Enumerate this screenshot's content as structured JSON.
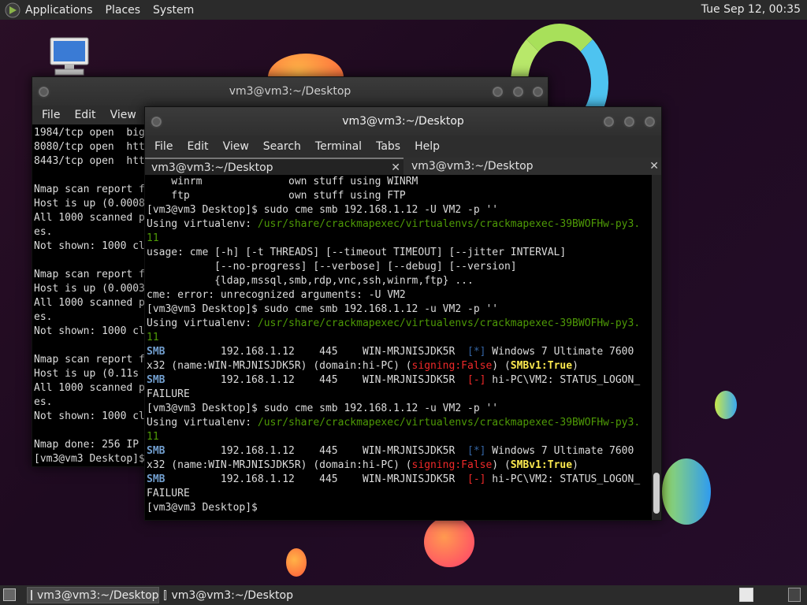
{
  "top_panel": {
    "menus": [
      "Applications",
      "Places",
      "System"
    ],
    "clock": "Tue Sep 12, 00:35"
  },
  "taskbar": {
    "tasks": [
      "vm3@vm3:~/Desktop",
      "vm3@vm3:~/Desktop"
    ]
  },
  "back_window": {
    "title": "vm3@vm3:~/Desktop",
    "menu": [
      "File",
      "Edit",
      "View"
    ],
    "lines": [
      "1984/tcp open  big",
      "8080/tcp open  htt",
      "8443/tcp open  htt",
      "",
      "Nmap scan report f",
      "Host is up (0.0008",
      "All 1000 scanned p",
      "es.",
      "Not shown: 1000 cl",
      "",
      "Nmap scan report f",
      "Host is up (0.0003",
      "All 1000 scanned p",
      "es.",
      "Not shown: 1000 cl",
      "",
      "Nmap scan report f",
      "Host is up (0.11s ",
      "All 1000 scanned p",
      "es.",
      "Not shown: 1000 cl",
      "",
      "Nmap done: 256 IP ",
      "[vm3@vm3 Desktop]$"
    ]
  },
  "front_window": {
    "title": "vm3@vm3:~/Desktop",
    "menu": [
      "File",
      "Edit",
      "View",
      "Search",
      "Terminal",
      "Tabs",
      "Help"
    ],
    "tabs": [
      "vm3@vm3:~/Desktop",
      "vm3@vm3:~/Desktop"
    ],
    "lines": [
      [
        {
          "t": "    winrm              own stuff using WINRM"
        }
      ],
      [
        {
          "t": "    ftp                own stuff using FTP"
        }
      ],
      [
        {
          "t": "[vm3@vm3 Desktop]$ sudo cme smb 192.168.1.12 -U VM2 -p ''"
        }
      ],
      [
        {
          "t": "Using virtualenv: "
        },
        {
          "t": "/usr/share/crackmapexec/virtualenvs/crackmapexec-39BWOFHw-py3.",
          "c": "c-green"
        }
      ],
      [
        {
          "t": "11",
          "c": "c-green"
        }
      ],
      [
        {
          "t": "usage: cme [-h] [-t THREADS] [--timeout TIMEOUT] [--jitter INTERVAL]"
        }
      ],
      [
        {
          "t": "           [--no-progress] [--verbose] [--debug] [--version]"
        }
      ],
      [
        {
          "t": "           {ldap,mssql,smb,rdp,vnc,ssh,winrm,ftp} ..."
        }
      ],
      [
        {
          "t": "cme: error: unrecognized arguments: -U VM2"
        }
      ],
      [
        {
          "t": "[vm3@vm3 Desktop]$ sudo cme smb 192.168.1.12 -u VM2 -p ''"
        }
      ],
      [
        {
          "t": "Using virtualenv: "
        },
        {
          "t": "/usr/share/crackmapexec/virtualenvs/crackmapexec-39BWOFHw-py3.",
          "c": "c-green"
        }
      ],
      [
        {
          "t": "11",
          "c": "c-green"
        }
      ],
      [
        {
          "t": "SMB",
          "c": "c-blue-b"
        },
        {
          "t": "         192.168.1.12    445    WIN-MRJNISJDK5R  "
        },
        {
          "t": "[*]",
          "c": "c-blue"
        },
        {
          "t": " Windows 7 Ultimate 7600"
        }
      ],
      [
        {
          "t": "x32 (name:WIN-MRJNISJDK5R) (domain:hi-PC) ("
        },
        {
          "t": "signing:False",
          "c": "c-red"
        },
        {
          "t": ") ("
        },
        {
          "t": "SMBv1:True",
          "c": "c-yellow-b"
        },
        {
          "t": ")"
        }
      ],
      [
        {
          "t": "SMB",
          "c": "c-blue-b"
        },
        {
          "t": "         192.168.1.12    445    WIN-MRJNISJDK5R  "
        },
        {
          "t": "[-]",
          "c": "c-red"
        },
        {
          "t": " hi-PC\\VM2: STATUS_LOGON_"
        }
      ],
      [
        {
          "t": "FAILURE"
        }
      ],
      [
        {
          "t": "[vm3@vm3 Desktop]$ sudo cme smb 192.168.1.12 -u VM2 -p ''"
        }
      ],
      [
        {
          "t": "Using virtualenv: "
        },
        {
          "t": "/usr/share/crackmapexec/virtualenvs/crackmapexec-39BWOFHw-py3.",
          "c": "c-green"
        }
      ],
      [
        {
          "t": "11",
          "c": "c-green"
        }
      ],
      [
        {
          "t": "SMB",
          "c": "c-blue-b"
        },
        {
          "t": "         192.168.1.12    445    WIN-MRJNISJDK5R  "
        },
        {
          "t": "[*]",
          "c": "c-blue"
        },
        {
          "t": " Windows 7 Ultimate 7600"
        }
      ],
      [
        {
          "t": "x32 (name:WIN-MRJNISJDK5R) (domain:hi-PC) ("
        },
        {
          "t": "signing:False",
          "c": "c-red"
        },
        {
          "t": ") ("
        },
        {
          "t": "SMBv1:True",
          "c": "c-yellow-b"
        },
        {
          "t": ")"
        }
      ],
      [
        {
          "t": "SMB",
          "c": "c-blue-b"
        },
        {
          "t": "         192.168.1.12    445    WIN-MRJNISJDK5R  "
        },
        {
          "t": "[-]",
          "c": "c-red"
        },
        {
          "t": " hi-PC\\VM2: STATUS_LOGON_"
        }
      ],
      [
        {
          "t": "FAILURE"
        }
      ],
      [
        {
          "t": "[vm3@vm3 Desktop]$"
        }
      ]
    ]
  },
  "colors": {
    "background": "#250d2a",
    "panel": "#2b2b2b",
    "terminal_bg": "#000000",
    "green": "#4e9a06",
    "red": "#ef2929",
    "yellow": "#fce94f",
    "blue": "#729fcf"
  }
}
